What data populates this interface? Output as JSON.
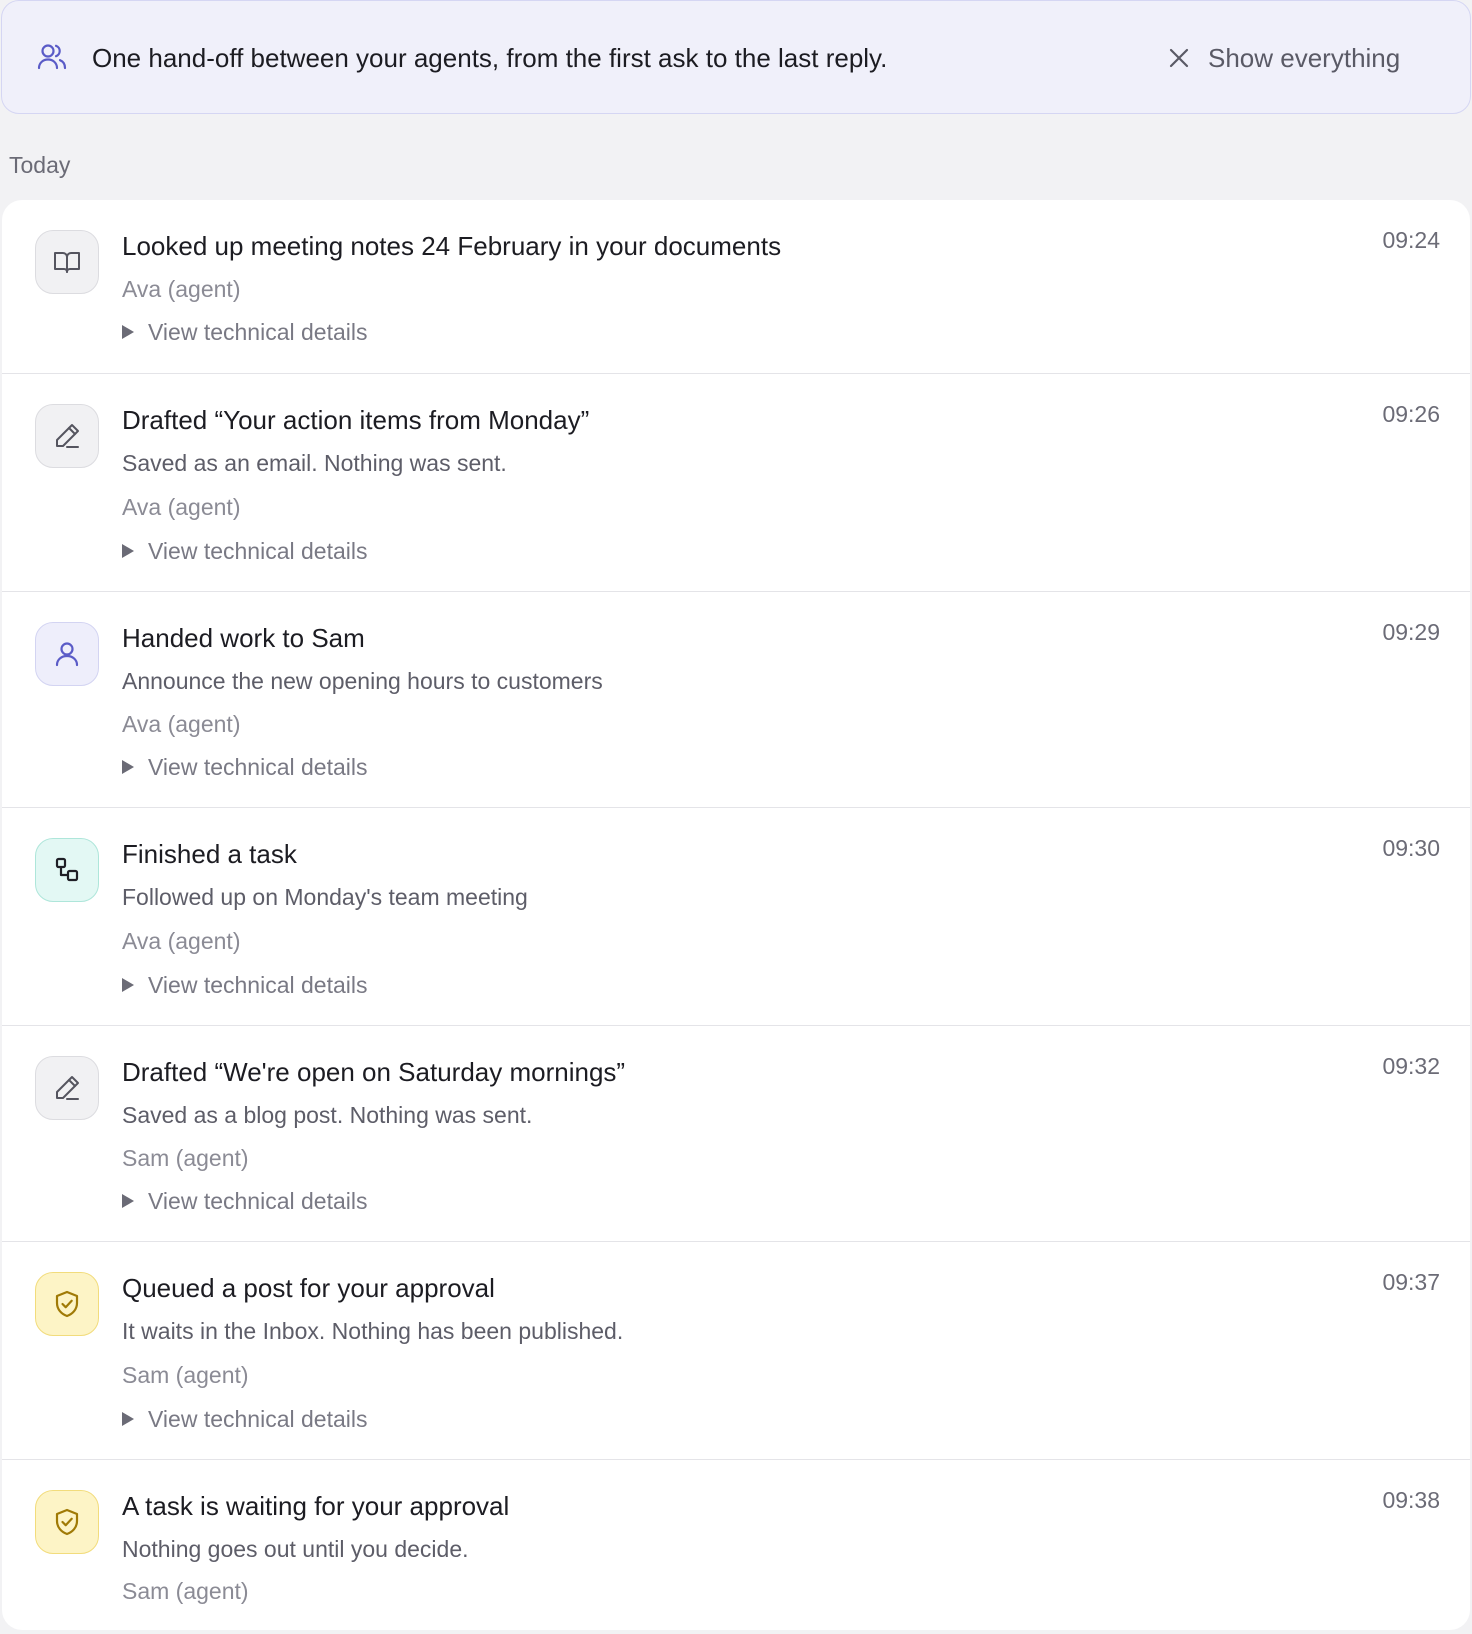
{
  "banner": {
    "icon": "people-icon",
    "text": "One hand-off between your agents, from the first ask to the last reply.",
    "close_icon": "close-icon",
    "show_all_label": "Show everything"
  },
  "day_label": "Today",
  "colors": {
    "accent": "#5a5bc7",
    "teal": "#2f9d8a",
    "amber": "#b0860a"
  },
  "events": [
    {
      "icon": "book-icon",
      "title": "Looked up meeting notes 24 February in your documents",
      "agent": "Ava (agent)",
      "details_label": "View technical details",
      "time": "09:24"
    },
    {
      "icon": "pencil-icon",
      "title": "Drafted “Your action items from Monday”",
      "description": "Saved as an email. Nothing was sent.",
      "agent": "Ava (agent)",
      "details_label": "View technical details",
      "time": "09:26"
    },
    {
      "icon": "person-icon",
      "title": "Handed work to Sam",
      "description": "Announce the new opening hours to customers",
      "agent": "Ava (agent)",
      "details_label": "View technical details",
      "time": "09:29"
    },
    {
      "icon": "workflow-icon",
      "title": "Finished a task",
      "description": "Followed up on Monday's team meeting",
      "agent": "Ava (agent)",
      "details_label": "View technical details",
      "time": "09:30"
    },
    {
      "icon": "pencil-icon",
      "title": "Drafted “We're open on Saturday mornings”",
      "description": "Saved as a blog post. Nothing was sent.",
      "agent": "Sam (agent)",
      "details_label": "View technical details",
      "time": "09:32"
    },
    {
      "icon": "shield-check-icon",
      "title": "Queued a post for your approval",
      "description": "It waits in the Inbox. Nothing has been published.",
      "agent": "Sam (agent)",
      "details_label": "View technical details",
      "time": "09:37"
    },
    {
      "icon": "shield-check-icon",
      "title": "A task is waiting for your approval",
      "description": "Nothing goes out until you decide.",
      "agent": "Sam (agent)",
      "time": "09:38"
    }
  ]
}
